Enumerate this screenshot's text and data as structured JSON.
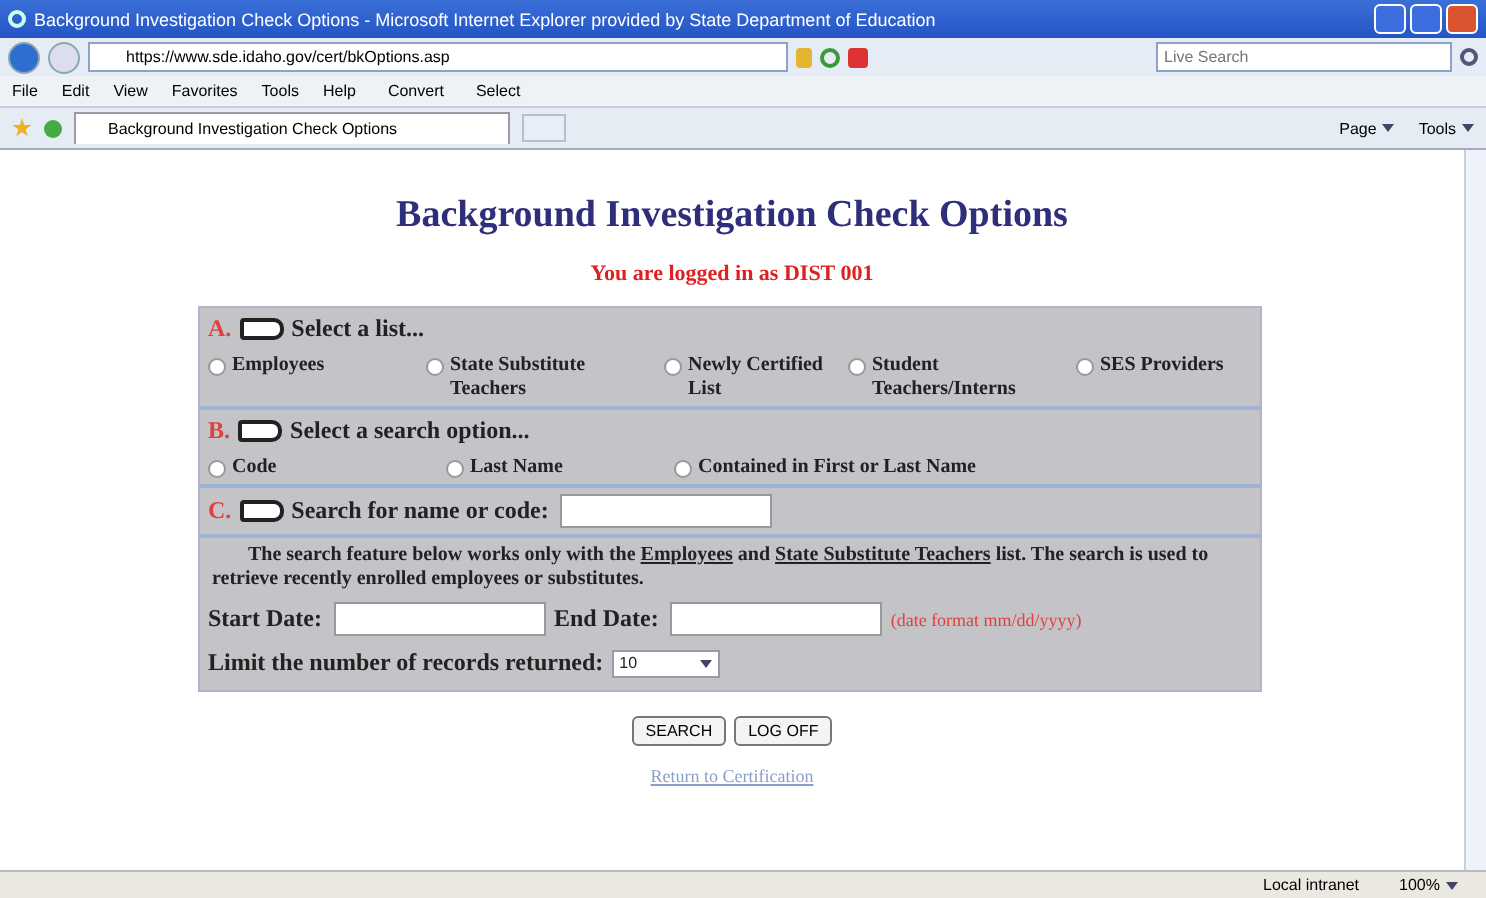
{
  "window": {
    "title": "Background Investigation Check Options - Microsoft Internet Explorer provided by State Department of Education"
  },
  "address_bar": {
    "url": "https://www.sde.idaho.gov/cert/bkOptions.asp",
    "search_placeholder": "Live Search"
  },
  "menu": [
    "File",
    "Edit",
    "View",
    "Favorites",
    "Tools",
    "Help"
  ],
  "toolbar": {
    "convert": "Convert",
    "select": "Select",
    "page": "Page",
    "tools": "Tools"
  },
  "tab": {
    "label": "Background Investigation Check Options"
  },
  "page": {
    "heading": "Background Investigation Check Options",
    "login_note": "You are logged in as DIST 001",
    "section_a": {
      "letter": "A.",
      "label": "Select a list...",
      "options": [
        {
          "label": "Employees",
          "selected": false
        },
        {
          "label": "State Substitute Teachers",
          "selected": false
        },
        {
          "label": "Newly Certified List",
          "selected": false
        },
        {
          "label": "Student Teachers/Interns",
          "selected": false
        },
        {
          "label": "SES Providers",
          "selected": false
        }
      ]
    },
    "section_b": {
      "letter": "B.",
      "label": "Select a search option...",
      "options": [
        {
          "label": "Code",
          "selected": false
        },
        {
          "label": "Last Name",
          "selected": false
        },
        {
          "label": "Contained in First or Last Name",
          "selected": false
        }
      ]
    },
    "section_c": {
      "letter": "C.",
      "label": "Search for name or code:"
    },
    "note": [
      {
        "text": "The search feature below works only with the ",
        "underline": false
      },
      {
        "text": "Employees",
        "underline": true
      },
      {
        "text": " and ",
        "underline": false
      },
      {
        "text": "State Substitute Teachers",
        "underline": true
      },
      {
        "text": " list. The search is used to retrieve recently enrolled employees or substitutes.",
        "underline": false
      }
    ],
    "start_date_label": "Start Date:",
    "end_date_label": "End Date:",
    "date_format": "(date format mm/dd/yyyy)",
    "limit_label": "Limit the number of records returned:",
    "limit_value": "10",
    "buttons": [
      "SEARCH",
      "LOG OFF"
    ],
    "link": "Return to Certification"
  },
  "status_bar": {
    "zone": "Local intranet",
    "zoom": "100%"
  }
}
